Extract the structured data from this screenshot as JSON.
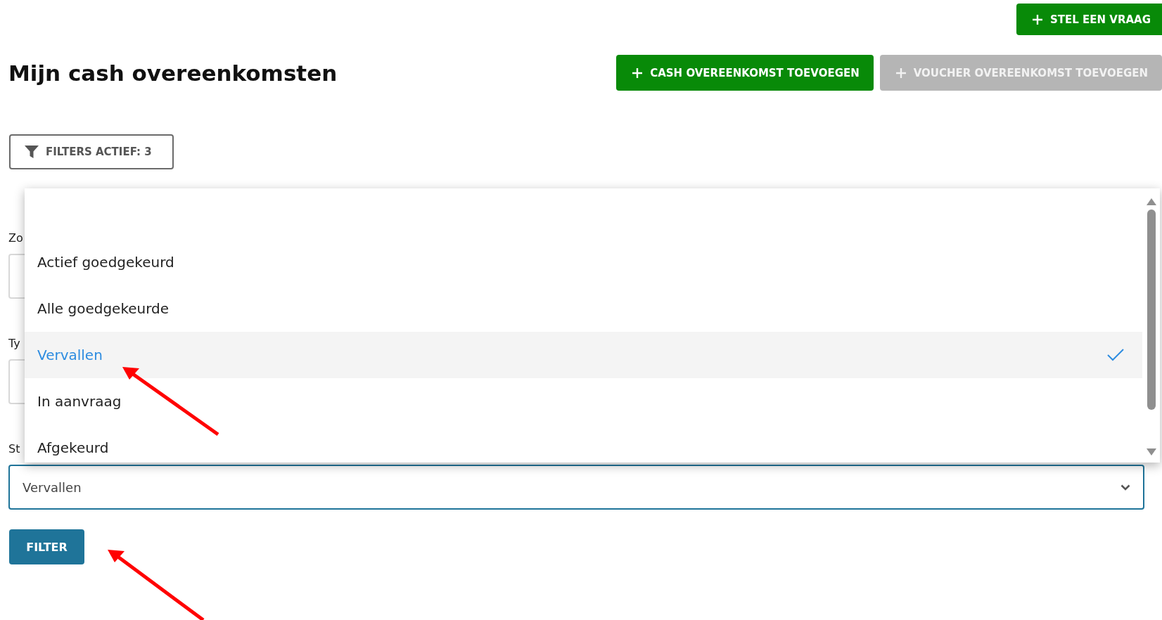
{
  "ask_button": {
    "label": "STEL EEN VRAAG"
  },
  "title": "Mijn cash overeenkomsten",
  "actions": [
    {
      "label": "CASH OVEREENKOMST TOEVOEGEN",
      "disabled": false
    },
    {
      "label": "VOUCHER OVEREENKOMST TOEVOEGEN",
      "disabled": true
    }
  ],
  "filters_button": {
    "label": "FILTERS ACTIEF: 3"
  },
  "fields": [
    {
      "label": "Zo",
      "focused": false
    },
    {
      "label": "Ty",
      "focused": false
    },
    {
      "label": "St",
      "value": "Vervallen",
      "focused": true
    }
  ],
  "dropdown": {
    "options": [
      {
        "label": "Actief goedgekeurd",
        "selected": false
      },
      {
        "label": "Alle goedgekeurde",
        "selected": false
      },
      {
        "label": "Vervallen",
        "selected": true
      },
      {
        "label": "In aanvraag",
        "selected": false
      },
      {
        "label": "Afgekeurd",
        "selected": false
      }
    ]
  },
  "filter_button": {
    "label": "FILTER"
  }
}
